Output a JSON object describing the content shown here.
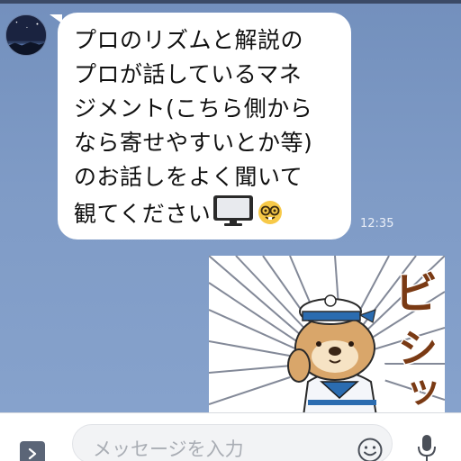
{
  "chat": {
    "message": {
      "text": "プロのリズムと解説の\nプロが話しているマネ\nジメント(こちら側から\nなら寄せやすいとか等)\nのお話しをよく聞いて\n観てください",
      "icons": [
        "tv-icon",
        "nerd-face-icon"
      ],
      "time": "12:35"
    },
    "sticker": {
      "caption": "ビシッ",
      "description_icon": "sailor-otter-sticker"
    },
    "avatar_icon": "night-sky-avatar"
  },
  "composer": {
    "placeholder": "メッセージを入力",
    "expand_icon": "chevron-right-icon",
    "emoji_icon": "smiley-icon",
    "mic_icon": "microphone-icon"
  },
  "colors": {
    "chat_background": "#7b97c2",
    "bubble": "#ffffff",
    "sticker_accent": "#2b6cb0"
  }
}
